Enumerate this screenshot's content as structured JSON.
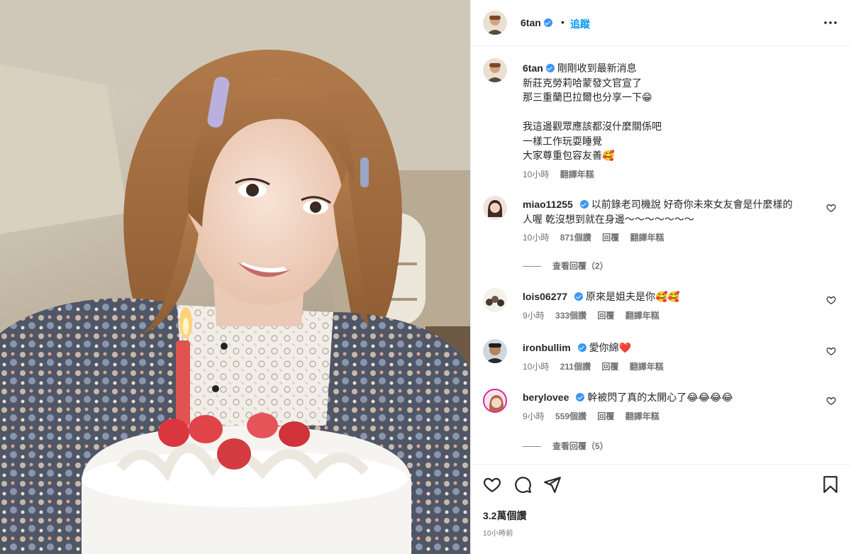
{
  "post": {
    "author": "6tan",
    "follow_label": "追蹤",
    "separator": "•",
    "caption_lines": [
      "剛剛收到最新消息",
      "新莊克勞莉哈蒙發文官宣了",
      "那三重蘭巴拉爾也分享一下😁",
      "",
      "我這邊觀眾應該都沒什麼關係吧",
      "一樣工作玩耍睡覺",
      "大家尊重包容友善🥰"
    ],
    "caption_time": "10小時",
    "translate_label": "翻譯年糕",
    "likes": "3.2萬個讚",
    "posted_ago": "10小時前"
  },
  "comments": [
    {
      "user": "miao11255",
      "verified": true,
      "text_lines": [
        "以前錄老司機說 好奇你未來女友會是什麼樣的",
        "人喔 乾沒想到就在身邊～～～～～～～"
      ],
      "time": "10小時",
      "likes": "871個讚",
      "reply": "回覆",
      "translate": "翻譯年糕",
      "view_replies": "查看回覆（2）"
    },
    {
      "user": "lois06277",
      "verified": true,
      "text_lines": [
        "原來是姐夫是你🥰🥰"
      ],
      "time": "9小時",
      "likes": "333個讚",
      "reply": "回覆",
      "translate": "翻譯年糕"
    },
    {
      "user": "ironbullim",
      "verified": true,
      "text_lines": [
        "愛你綿❤️"
      ],
      "time": "10小時",
      "likes": "211個讚",
      "reply": "回覆",
      "translate": "翻譯年糕"
    },
    {
      "user": "berylovee",
      "verified": true,
      "text_lines": [
        "幹被閃了真的太開心了😂😂😂😂"
      ],
      "time": "9小時",
      "likes": "559個讚",
      "reply": "回覆",
      "translate": "翻譯年糕",
      "view_replies": "查看回覆（5）"
    }
  ],
  "icons": {
    "like": "heart-icon",
    "comment": "comment-icon",
    "share": "share-icon",
    "save": "bookmark-icon",
    "more": "more-icon"
  },
  "colors": {
    "accent": "#0095f6",
    "verified": "#3897f0",
    "text": "#262626",
    "secondary": "#737373"
  }
}
